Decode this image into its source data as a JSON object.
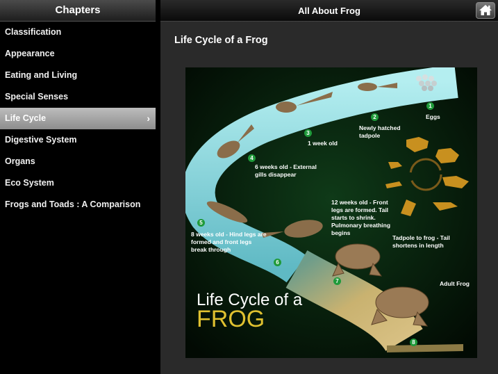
{
  "sidebar": {
    "title": "Chapters",
    "items": [
      {
        "label": "Classification"
      },
      {
        "label": "Appearance"
      },
      {
        "label": "Eating and Living"
      },
      {
        "label": "Special Senses"
      },
      {
        "label": "Life Cycle",
        "selected": true
      },
      {
        "label": "Digestive System"
      },
      {
        "label": "Organs"
      },
      {
        "label": "Eco System"
      },
      {
        "label": "Frogs and Toads : A Comparison"
      }
    ]
  },
  "header": {
    "title": "All About Frog",
    "home_icon": "home-icon"
  },
  "content": {
    "title": "Life Cycle of a Frog",
    "diagram": {
      "title_line1": "Life Cycle of a",
      "title_line2": "FROG",
      "stages": [
        {
          "number": "1",
          "label": "Eggs"
        },
        {
          "number": "2",
          "label": "Newly hatched tadpole"
        },
        {
          "number": "3",
          "label": "1 week old"
        },
        {
          "number": "4",
          "label": "6 weeks old - External gills disappear"
        },
        {
          "number": "5",
          "label": "8 weeks old - Hind legs are formed and front legs break through"
        },
        {
          "number": "6",
          "label": "12 weeks old - Front legs are formed. Tail starts to shrink. Pulmonary breathing begins"
        },
        {
          "number": "7",
          "label": "Tadpole to frog - Tail shortens in length"
        },
        {
          "number": "8",
          "label": "Adult Frog"
        }
      ]
    }
  },
  "colors": {
    "water": "#8fd6dc",
    "sand": "#c9b270",
    "title_accent": "#e0c130",
    "badge": "#1f9a3a",
    "silhouette": "#c8901f"
  }
}
